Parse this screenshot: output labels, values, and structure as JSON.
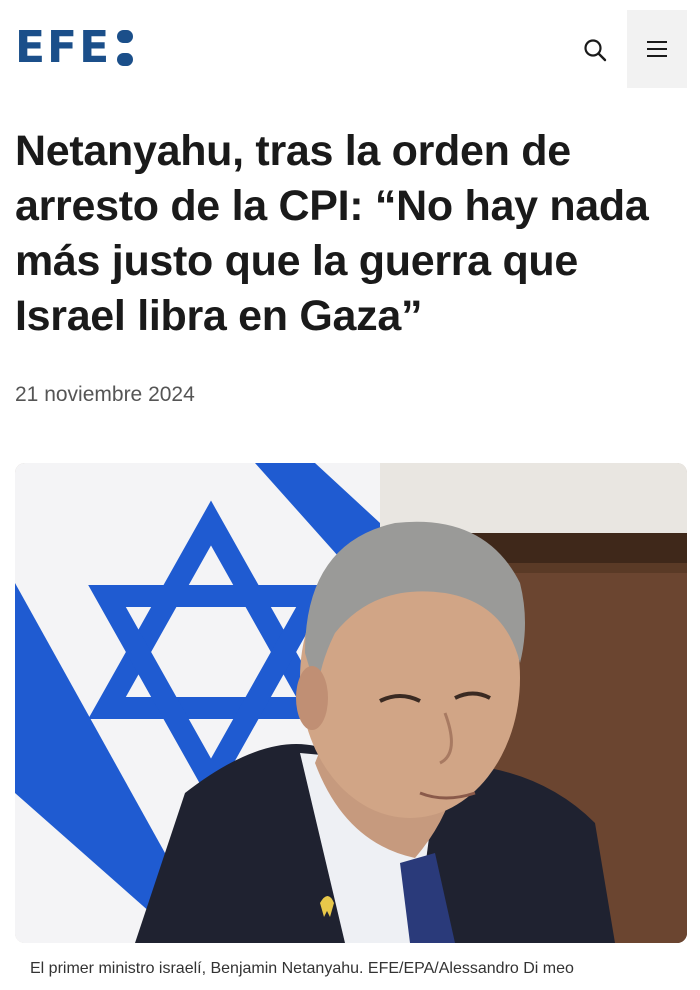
{
  "header": {
    "logo_text": "EFE",
    "logo_icon": "efe-colon-mark",
    "search_icon": "search-icon",
    "menu_icon": "hamburger-menu-icon"
  },
  "article": {
    "headline": "Netanyahu, tras la orden de arresto de la CPI: “No hay nada más justo que la guerra que Israel libra en Gaza”",
    "date": "21 noviembre 2024",
    "image_caption": "El primer ministro israelí, Benjamin Netanyahu. EFE/EPA/Alessandro Di meo"
  },
  "colors": {
    "brand": "#1b4f8a",
    "text": "#1a1a1a",
    "muted": "#555555",
    "flag_blue": "#1f5bd1"
  }
}
